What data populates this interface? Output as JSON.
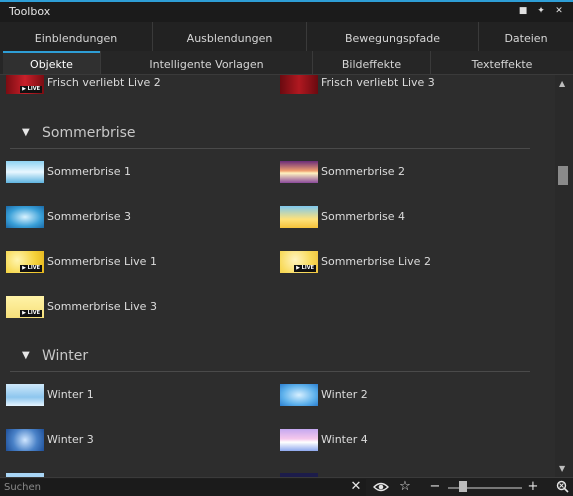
{
  "window": {
    "title": "Toolbox"
  },
  "tabs_top": [
    "Einblendungen",
    "Ausblendungen",
    "Bewegungspfade",
    "Dateien"
  ],
  "tabs_sub": [
    "Objekte",
    "Intelligente Vorlagen",
    "Bildeffekte",
    "Texteffekte"
  ],
  "active_sub_tab": "Objekte",
  "live_badge": "▶ LIVE",
  "top_items": [
    "Frisch verliebt Live 2",
    "Frisch verliebt Live 3"
  ],
  "sections": [
    {
      "title": "Sommerbrise",
      "items": [
        "Sommerbrise 1",
        "Sommerbrise 2",
        "Sommerbrise 3",
        "Sommerbrise 4",
        "Sommerbrise Live 1",
        "Sommerbrise Live 2",
        "Sommerbrise Live 3"
      ]
    },
    {
      "title": "Winter",
      "items": [
        "Winter 1",
        "Winter 2",
        "Winter 3",
        "Winter 4"
      ]
    }
  ],
  "search": {
    "placeholder": "Suchen"
  },
  "icons": {
    "window_controls": [
      "restore-icon",
      "pin-icon",
      "close-icon"
    ],
    "section_toggle": "▼",
    "bottom": [
      "clear-icon",
      "eye-icon",
      "star-icon",
      "zoom-out-icon",
      "zoom-in-icon",
      "zoom-fit-icon"
    ]
  },
  "zoom_level": 0.2,
  "colors": {
    "accent": "#2e9ed6",
    "background": "#2d2d2d"
  }
}
